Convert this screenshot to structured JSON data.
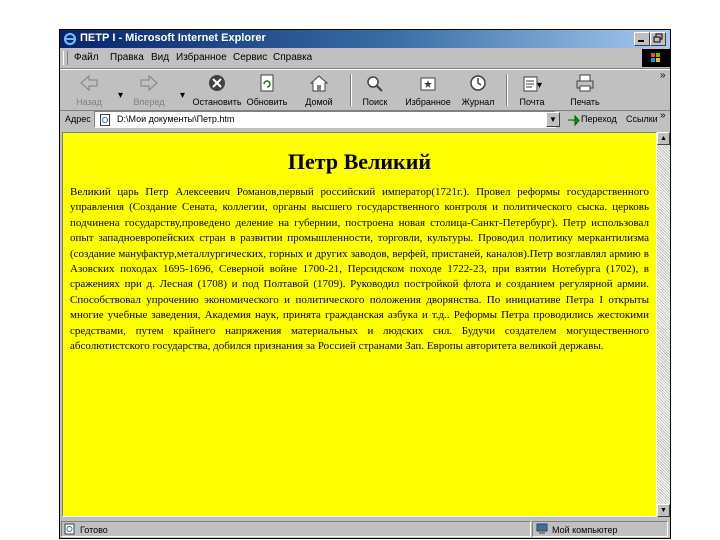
{
  "window": {
    "title": "ПЕТР I - Microsoft Internet Explorer"
  },
  "menu": {
    "items": [
      "Файл",
      "Правка",
      "Вид",
      "Избранное",
      "Сервис",
      "Справка"
    ]
  },
  "toolbar": {
    "back": "Назад",
    "forward": "Вперед",
    "stop": "Остановить",
    "refresh": "Обновить",
    "home": "Домой",
    "search": "Поиск",
    "favorites": "Избранное",
    "history": "Журнал",
    "mail": "Почта",
    "print": "Печать"
  },
  "address": {
    "label": "Адрес",
    "value": "D:\\Мои документы\\Петр.htm",
    "go": "Переход",
    "links": "Ссылки"
  },
  "page": {
    "title": "Петр Великий",
    "body": "Великий царь Петр Алексеевич Романов,первый российский император(1721г.). Провел реформы государственного управления (Создание Сената, коллегии, органы высшего государственного контроля и политического сыска. церковь подчинена государству,проведено деление на губернии, построена новая столица-Санкт-Петербург). Петр использовал опыт западноевропейских стран в развитии промышленности, торговли, культуры. Проводил политику меркантилизма (создание мануфактур,металлургических, горных и других заводов, верфей, пристаней, каналов).Петр возглавлял армию в Азовских походах 1695-1696, Северной войне 1700-21, Персидском походе 1722-23, при взятии Нотебурга (1702), в сражениях при д. Лесная (1708) и под Полтавой (1709). Руководил постройкой флота и созданием регулярной армии. Способствовал упрочению экономического и политического положения дворянства. По инициативе Петра I открыты многие учебные заведения, Академия наук, принята гражданская азбука и т.д.. Реформы Петра проводились жестокими средствами, путем крайнего напряжения материальных и людских сил. Будучи создателем могущественного абсолютистского государства, добился признания за Россией странами Зап. Европы авторитета великой державы."
  },
  "status": {
    "left": "Готово",
    "zone": "Мой компьютер"
  },
  "colors": {
    "page_background": "#ffff00",
    "titlebar": "#08246b"
  }
}
